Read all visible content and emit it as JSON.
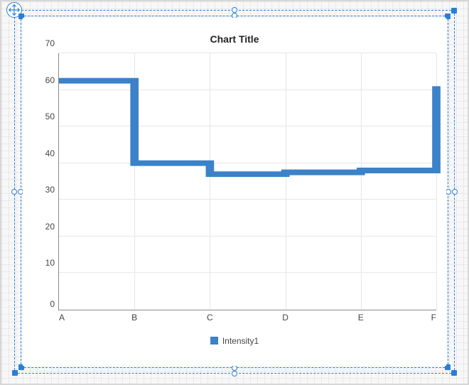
{
  "chart_data": {
    "type": "line",
    "title": "Chart Title",
    "xlabel": "",
    "ylabel": "",
    "categories": [
      "A",
      "B",
      "C",
      "D",
      "E",
      "F"
    ],
    "values": [
      62.5,
      40,
      37,
      37.5,
      38,
      51,
      61
    ],
    "ylim": [
      0,
      70
    ],
    "yticks": [
      0,
      10,
      20,
      30,
      40,
      50,
      60,
      70
    ],
    "series_name": "Intensity1",
    "series_color": "#3b82c9",
    "grid": true
  },
  "designer": {
    "selected": true,
    "move_handle": "move-icon"
  },
  "legend": {
    "label": "Intensity1"
  },
  "y_axis_labels": {
    "t0": "0",
    "t1": "10",
    "t2": "20",
    "t3": "30",
    "t4": "40",
    "t5": "50",
    "t6": "60",
    "t7": "70"
  },
  "x_axis_labels": {
    "c0": "A",
    "c1": "B",
    "c2": "C",
    "c3": "D",
    "c4": "E",
    "c5": "F"
  },
  "title": "Chart Title"
}
